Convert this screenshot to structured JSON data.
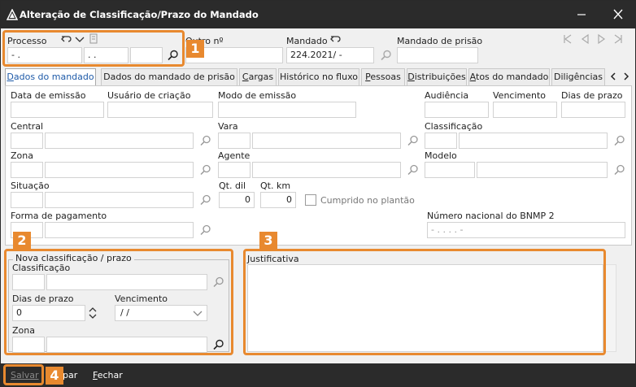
{
  "window": {
    "title": "Alteração de Classificação/Prazo do Mandado"
  },
  "header": {
    "processo_label": "Processo",
    "processo_part1": "  -  .",
    "processo_part2": " .  .",
    "processo_part3": "",
    "processo_part4": "",
    "outro_label": "Outro nº",
    "outro_value": "",
    "mandado_label": "Mandado",
    "mandado_value": "224.2021/    -",
    "mandado_prisao_label": "Mandado de prisão",
    "mandado_prisao_value": ""
  },
  "tabs": [
    {
      "label": "Dados do mandado",
      "ul": "D",
      "rest": "ados do mandado"
    },
    {
      "label": "Dados do mandado de prisão",
      "ul": "",
      "rest": "Dados do mandado de prisão"
    },
    {
      "label": "Cargas",
      "ul": "C",
      "rest": "argas"
    },
    {
      "label": "Histórico no fluxo",
      "ul": "",
      "rest": "Histórico no fluxo"
    },
    {
      "label": "Pessoas",
      "ul": "P",
      "rest": "essoas"
    },
    {
      "label": "Distribuições",
      "ul": "D",
      "rest": "istribuições"
    },
    {
      "label": "Atos do mandado",
      "ul": "A",
      "rest": "tos do mandado"
    },
    {
      "label": "Diligências",
      "ul": "",
      "rest": "Diligências"
    }
  ],
  "panel": {
    "data_emissao": "Data de emissão",
    "usuario_criacao": "Usuário de criação",
    "modo_emissao": "Modo de emissão",
    "audiencia": "Audiência",
    "vencimento": "Vencimento",
    "dias_prazo": "Dias de prazo",
    "central": "Central",
    "vara": "Vara",
    "classificacao": "Classificação",
    "zona": "Zona",
    "agente": "Agente",
    "modelo": "Modelo",
    "situacao": "Situação",
    "qt_dil": "Qt. dil",
    "qt_dil_value": "0",
    "qt_km": "Qt. km",
    "qt_km_value": "0",
    "cumprido_plantao": "Cumprido no plantão",
    "forma_pagamento": "Forma de pagamento",
    "bnmp_label": "Número nacional do BNMP 2",
    "bnmp_value": "   -   .  .   .  .   -  "
  },
  "nova": {
    "title": "Nova classificação / prazo",
    "classificacao": "Classificação",
    "dias_prazo": "Dias de prazo",
    "dias_prazo_value": "0",
    "vencimento": "Vencimento",
    "vencimento_value": " / /",
    "zona": "Zona"
  },
  "justificativa": {
    "label": "Justificativa",
    "value": ""
  },
  "callouts": [
    "1",
    "2",
    "3",
    "4"
  ],
  "bottom": {
    "salvar": "Salvar",
    "limpar": "par",
    "fechar_ul": "F",
    "fechar_rest": "echar"
  },
  "colors": {
    "accent": "#e8892f",
    "titlebar": "#2b2b2b",
    "active_tab": "#1e5aa8"
  }
}
